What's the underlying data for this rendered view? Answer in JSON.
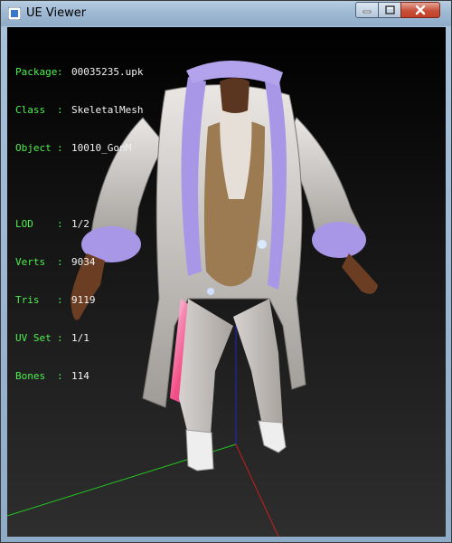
{
  "window": {
    "title": "UE Viewer",
    "controls": {
      "minimize": "minimize",
      "maximize": "maximize",
      "close": "close"
    }
  },
  "info": {
    "package_label": "Package",
    "package_value": "00035235.upk",
    "class_label": "Class",
    "class_value": "SkeletalMesh",
    "object_label": "Object",
    "object_value": "10010_GonM",
    "lod_label": "LOD",
    "lod_value": "1/2",
    "verts_label": "Verts",
    "verts_value": "9034",
    "tris_label": "Tris",
    "tris_value": "9119",
    "uvset_label": "UV Set",
    "uvset_value": "1/1",
    "bones_label": "Bones",
    "bones_value": "114",
    "separator": ":"
  },
  "colors": {
    "info_label": "#4ef04e",
    "info_value": "#f2f2f2",
    "axis_x": "#c81e1e",
    "axis_y": "#22c822",
    "axis_z": "#2222d0"
  }
}
